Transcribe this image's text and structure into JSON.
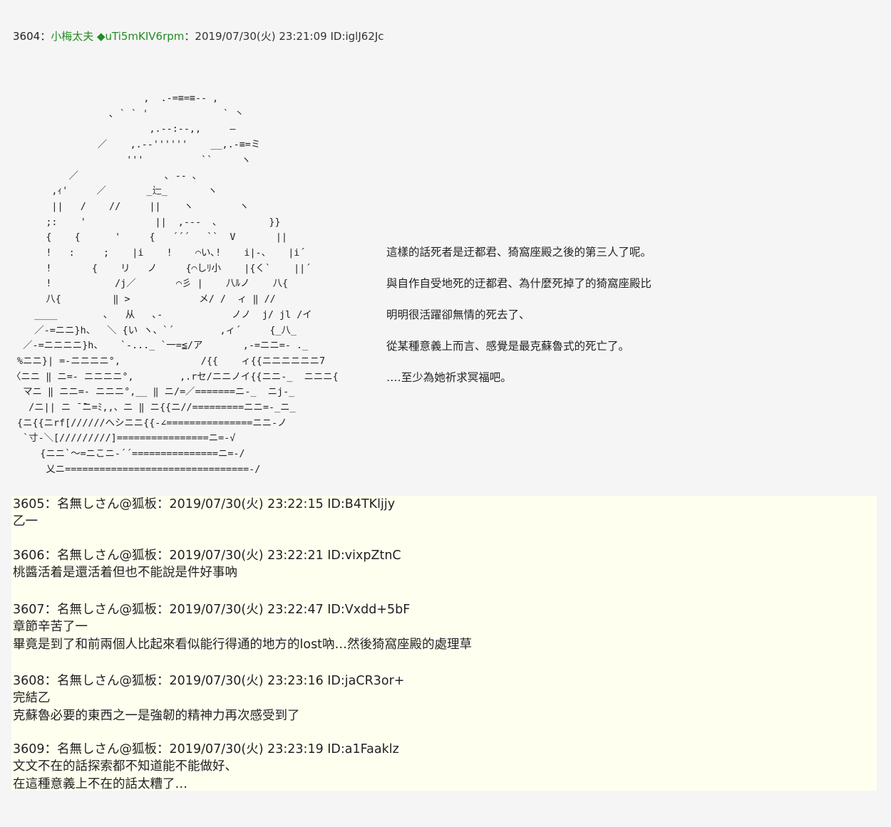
{
  "main_post": {
    "number": "3604",
    "separator": "：",
    "name": "小梅太夫 ◆uTi5mKIV6rpm",
    "meta": "：2019/07/30(火) 23:21:09 ID:iglJ62Jc"
  },
  "ascii_art": [
    "                       ,  .-=≡=≡-- ,",
    "                 ､ ` ` '             ` 丶",
    "                        ,.--:--,,     ―",
    "               ／    ,.-‐''''''    __,.-≡=ミ",
    "                    '''          ``     ヽ",
    "          ／               ､ ‐‐ ､",
    "       ,ｨ'     ／       _辷_       ヽ",
    "       ||   /    //     ||    ヽ        ヽ",
    "      ;:    '            ||  ,-‐-  ､         }}",
    "      {    {      '     {   ´´´   ``  V       ||",
    "      !   :     ;    |i    !    ⌒い､!    i|-、   |i´",
    "      !       {    リ   ノ     {⌒しﾘ小    |{く`    ||´",
    "      !           /j／       ⌒彡 |    八ﾙノ    八{",
    "      八{         ‖ >            メ/ /  ィ ‖ //",
    "    ____        ､   从   ､-            ノノ  j/ jl /イ",
    "    ／-=ニニ}h、  ＼ {い ヽ、`´        ,ィ´     {_八_",
    "  ／-=ニニニニ}h、   `‐..._ `一=≦/ア       ,‐=ニニ=- ._",
    " %ニニ}| =-ニニニニ°,              /{{    ィ{{ニニニニニニ7",
    "〈ニニ ‖ ニ=- ニニニニ°,        ,.rセ/ニニノイ{{ニニ-_  ニニニ{",
    "  マニ ‖ ニニ=- ニニニ°,__ ‖ ニ/=／=======ニ-_  ニj-_",
    "   /ニ|| ニ ̄ ̄ニ=ﾐ,,、ニ ‖ ニ{{ニ//=========ニニ=-_ニ_",
    " {ニ{{ニrf[//////へシニニ{{-∠===============ニニ-ノ",
    "  `寸-＼[/////////]================ニ=-√",
    "     {ニニ`～=ニこニ-´´===============ニ=-/",
    "      乂ニ================================-/"
  ],
  "side_lines": [
    "這樣的話死者是迂都君、猗窩座殿之後的第三人了呢。",
    " 與自作自受地死的迂都君、為什麼死掉了的猗窩座殿比",
    "明明很活躍卻無情的死去了、",
    " 從某種意義上而言、感覺是最克蘇魯式的死亡了。",
    "  ‥‥至少為她祈求冥福吧。"
  ],
  "replies": [
    {
      "header": "3605：名無しさん@狐板：2019/07/30(火) 23:22:15 ID:B4TKljjy",
      "lines": [
        "乙一"
      ]
    },
    {
      "header": "3606：名無しさん@狐板：2019/07/30(火) 23:22:21 ID:vixpZtnC",
      "lines": [
        "桃醬活着是還活着但也不能說是件好事吶"
      ]
    },
    {
      "header": "3607：名無しさん@狐板：2019/07/30(火) 23:22:47 ID:Vxdd+5bF",
      "lines": [
        "章節辛苦了一",
        "畢竟是到了和前兩個人比起來看似能行得通的地方的lost吶…然後猗窩座殿的處理草"
      ]
    },
    {
      "header": "3608：名無しさん@狐板：2019/07/30(火) 23:23:16 ID:jaCR3or+",
      "lines": [
        "完結乙",
        "克蘇魯必要的東西之一是強韌的精神力再次感受到了"
      ]
    },
    {
      "header": "3609：名無しさん@狐板：2019/07/30(火) 23:23:19 ID:a1Faaklz",
      "lines": [
        "文文不在的話探索都不知道能不能做好、",
        "在這種意義上不在的話太糟了…"
      ]
    }
  ]
}
